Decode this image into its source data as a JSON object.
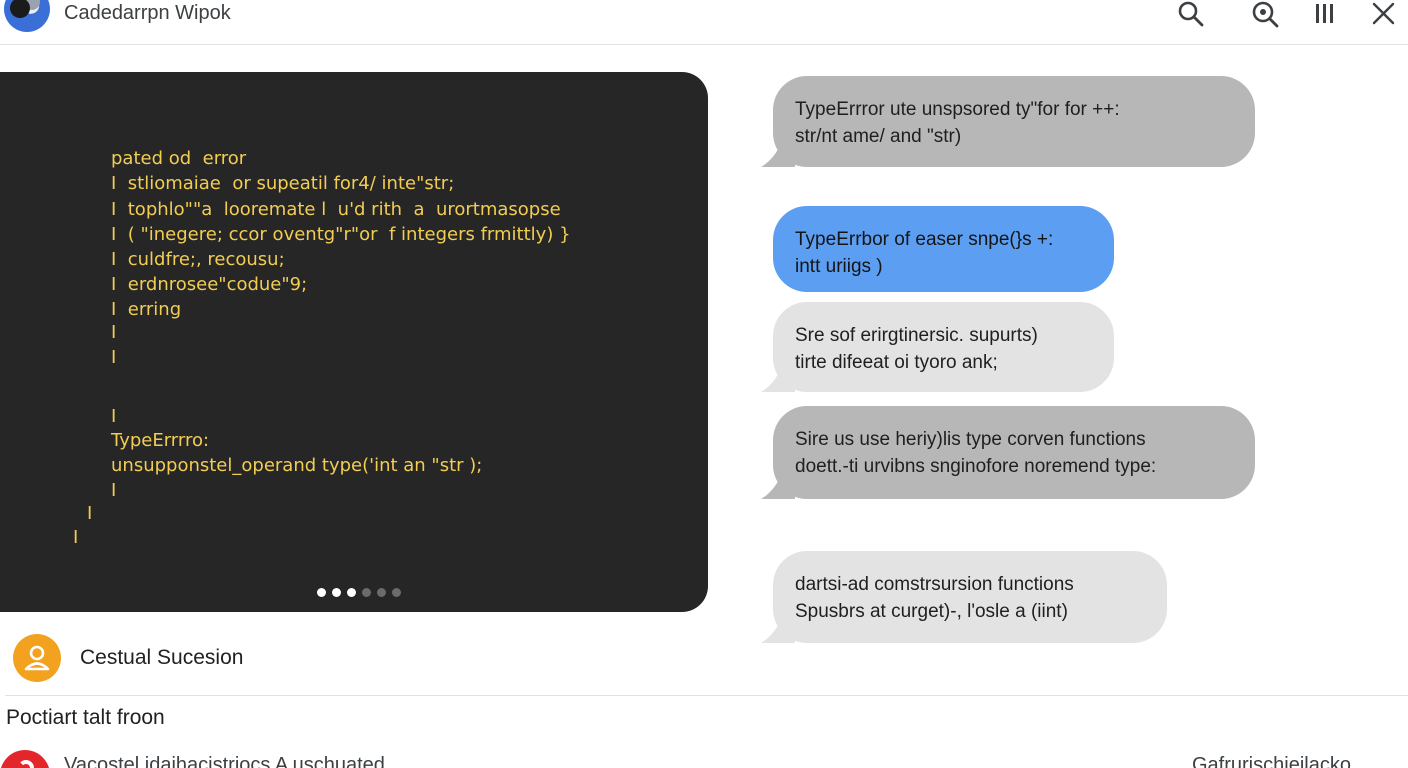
{
  "header": {
    "title": "Cadedarrpn Wipok",
    "icons": [
      "search-icon",
      "zoom-in-icon",
      "columns-icon",
      "close-icon"
    ]
  },
  "code": {
    "lines": [
      "pated od  error",
      "I  stliomaiae  or supeatil for4/ inte\"str;",
      "I  tophlo\"\"a  looremate l  u'd rith  a  urortmasopse",
      "I  ( \"inegere; ccor oventg\"r\"or  f integers frmittly) }",
      "I  culdfre;, recousu;",
      "I  erdnrosee\"codue\"9;",
      "I  erring",
      "I",
      "I",
      "I",
      "TypeErrrro:",
      "unsupponstel_operand type('int an \"str );",
      "I",
      "I",
      "I"
    ],
    "carousel_total": 6,
    "carousel_active": [
      0,
      1,
      2
    ]
  },
  "chat": {
    "messages": [
      {
        "lines": [
          "TypeErrror  ute unspsored ty\"for for ++:",
          "str/nt ame/ and \"str)"
        ]
      },
      {
        "lines": [
          "TypeErrbor of easer snpe(}s +:",
          "intt uriigs )"
        ]
      },
      {
        "lines": [
          "Sre sof erirgtinersic. supurts)",
          "tirte difeeat oi tyoro  ank;"
        ]
      },
      {
        "lines": [
          "Sire us use heriy)lis type corven functions",
          "doett.-ti urvibns snginofore noremend  type:"
        ]
      },
      {
        "lines": [
          "dartsi-ad comstrsursion functions",
          "Spusbrs at curget)-,  l'osle a (iint)"
        ]
      }
    ]
  },
  "user": {
    "name": "Cestual Sucesion"
  },
  "section": {
    "title": "Poctiart talt froon",
    "item_text": "Vacostel idaihacistriocs A uschuated",
    "item_right": "Gafrurischieilacko"
  },
  "colors": {
    "code_bg": "#262626",
    "code_text": "#f2cd52",
    "bubble_gray": "#b7b7b7",
    "bubble_light": "#e3e3e3",
    "bubble_blue": "#5b9ef2",
    "avatar": "#f2a21e",
    "red_icon": "#e3262c"
  }
}
